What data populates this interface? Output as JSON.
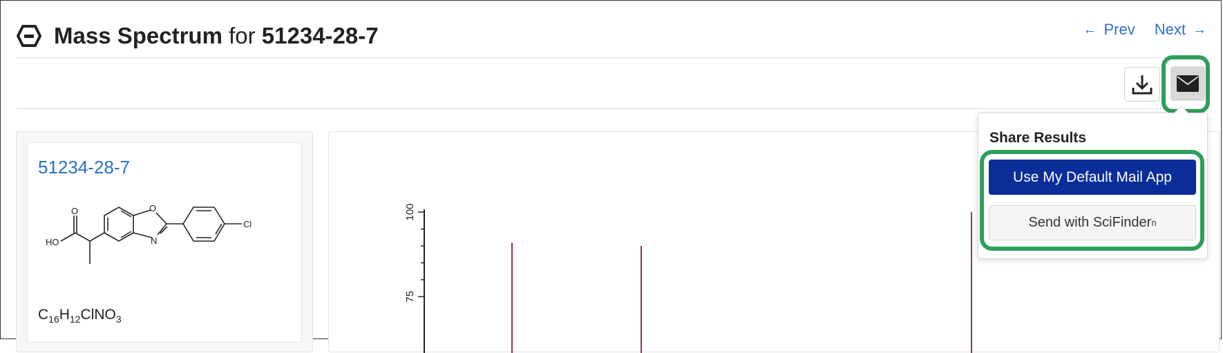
{
  "header": {
    "title_main": "Mass Spectrum",
    "title_for": " for ",
    "title_cas": "51234-28-7"
  },
  "nav": {
    "prev_label": "Prev",
    "next_label": "Next"
  },
  "toolbar": {
    "download_icon": "download-icon",
    "mail_icon": "mail-icon"
  },
  "compound": {
    "cas_link": "51234-28-7",
    "formula_parts": [
      "C",
      "16",
      "H",
      "12",
      "ClNO",
      "3"
    ],
    "structure_labels": {
      "o_carbonyl": "O",
      "hydroxyl": "HO",
      "ring_o": "O",
      "ring_n": "N",
      "chlorine": "Cl"
    }
  },
  "share": {
    "title": "Share Results",
    "default_mail_label": "Use My Default Mail App",
    "scifinder_label": "Send with SciFinder",
    "scifinder_sup": "n"
  },
  "chart_data": {
    "type": "bar",
    "y_tick_labels": [
      "100",
      "75"
    ],
    "ylim": [
      70,
      100
    ],
    "peaks": [
      {
        "id": "p1",
        "relative_intensity": 91
      },
      {
        "id": "p2",
        "relative_intensity": 90
      },
      {
        "id": "p3",
        "relative_intensity": 100
      }
    ],
    "colors": {
      "peak": "#a4303f",
      "axis": "#222222"
    }
  }
}
